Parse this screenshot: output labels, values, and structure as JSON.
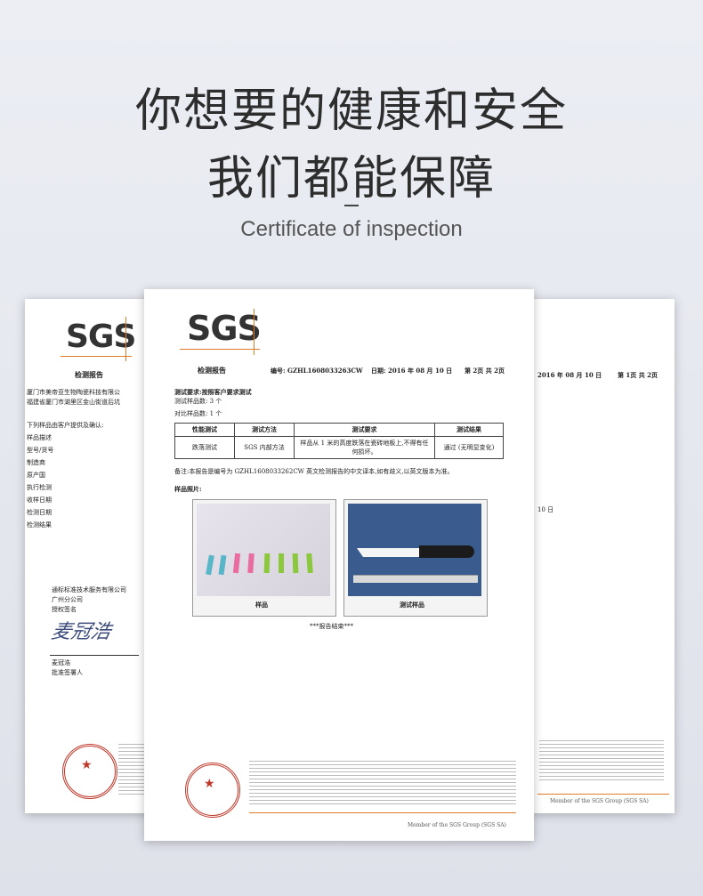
{
  "headline": {
    "line1": "你想要的健康和安全",
    "line2": "我们都能保障",
    "subtitle": "Certificate of inspection"
  },
  "left_page": {
    "logo": "SGS",
    "title": "检测报告",
    "company_lines": [
      "厦门市美帝亚生物陶瓷科技有限公",
      "福建省厦门市湖里区金山街道后坑"
    ],
    "fields": [
      "下列样品由客户提供及确认:",
      "样品描述",
      "型号/货号",
      "制造商",
      "原产国",
      "执行检测",
      "收样日期",
      "检测日期",
      "检测结果"
    ],
    "org_lines": [
      "通标标准技术服务有限公司",
      "广州分公司",
      "授权签名"
    ],
    "signature": "麦冠浩",
    "signer_lines": [
      "麦冠浩",
      "批准签署人"
    ]
  },
  "main_page": {
    "logo": "SGS",
    "title": "检测报告",
    "report_no": "编号: GZHL1608033263CW",
    "date": "日期: 2016 年 08 月 10 日",
    "page_no": "第 2页 共 2页",
    "req_label": "测试要求:按照客户要求测试",
    "sample_count": "测试样品数: 3 个",
    "compare_count": "对比样品数: 1 个",
    "table_header": [
      "性能测试",
      "测试方法",
      "测试要求",
      "测试结果"
    ],
    "table_row": [
      "跌落测试",
      "SGS 内部方法",
      "样品从 1 米的高度跌落在瓷砖地板上,不得有任何损坏。",
      "通过 (无明显变化)"
    ],
    "note": "备注:本报告是编号为 GZHL1608033262CW 英文检测报告的中文译本,如有歧义,以英文版本为准。",
    "photos_label": "样品照片:",
    "photo1_caption": "样品",
    "photo2_caption": "测试样品",
    "end": "***报告结束***",
    "member": "Member of the SGS Group (SGS SA)"
  },
  "right_page": {
    "date": "2016 年 08 月 10 日",
    "page_no": "第 1页 共 2页",
    "date_short": "10 日",
    "member": "Member of the SGS Group (SGS SA)"
  },
  "colors": {
    "accent": "#e07a2b",
    "stamp": "#c0392b",
    "background": "#e4e6ee"
  }
}
